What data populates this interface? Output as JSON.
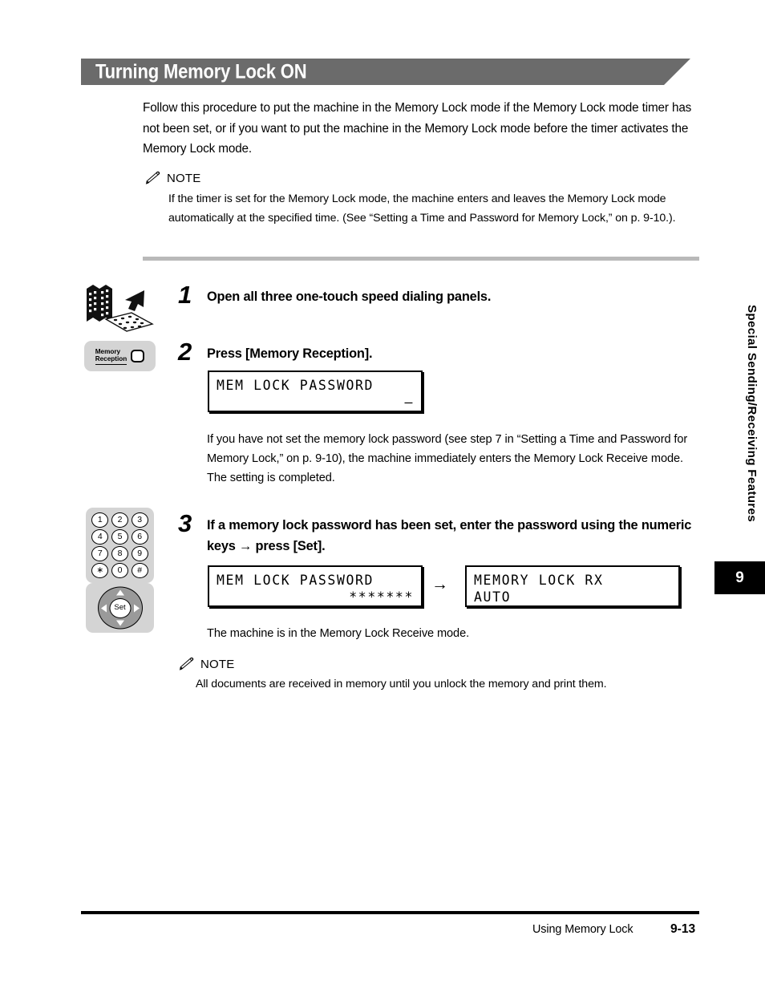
{
  "header": {
    "title": "Turning Memory Lock ON"
  },
  "intro": {
    "text": "Follow this procedure to put the machine in the Memory Lock mode if the Memory Lock mode timer has not been set, or if you want to put the machine in the Memory Lock mode before the timer activates the Memory Lock mode."
  },
  "notes": [
    {
      "label": "NOTE",
      "body": "If the timer is set for the Memory Lock mode, the machine enters and leaves the Memory Lock mode automatically at the specified time. (See “Setting a Time and Password for Memory Lock,” on p. 9-10.)."
    },
    {
      "label": "NOTE",
      "body": "All documents are received in memory until you unlock the memory and print them."
    }
  ],
  "steps": [
    {
      "number": "1",
      "heading": "Open all three one-touch speed dialing panels."
    },
    {
      "number": "2",
      "heading": "Press [Memory Reception].",
      "body": "If you have not set the memory lock password (see step 7 in “Setting a Time and Password for Memory Lock,” on p. 9-10), the machine immediately enters the Memory Lock Receive mode. The setting is completed."
    },
    {
      "number": "3",
      "heading": "If a memory lock password has been set, enter the password using the numeric keys → press [Set].",
      "body": "The machine is in the Memory Lock Receive mode."
    }
  ],
  "lcd": {
    "step2": {
      "line1": "MEM LOCK PASSWORD",
      "line2": "–"
    },
    "step3_before": {
      "line1": "MEM LOCK PASSWORD",
      "line2": "*******"
    },
    "arrow": "→",
    "step3_after": {
      "line1": "MEMORY LOCK RX",
      "line2": "AUTO"
    }
  },
  "keys": {
    "memory_reception": {
      "line1": "Memory",
      "line2": "Reception"
    },
    "numeric_keypad": [
      "1",
      "2",
      "3",
      "4",
      "5",
      "6",
      "7",
      "8",
      "9",
      "∗",
      "0",
      "#"
    ],
    "set_button": "Set"
  },
  "sidebar": {
    "chapter_title": "Special Sending/Receiving Features",
    "chapter_number": "9"
  },
  "footer": {
    "section": "Using Memory Lock",
    "page": "9-13"
  },
  "colors": {
    "banner": "#6b6b6b",
    "divider": "#b9b9b9",
    "key_panel": "#d4d4d4",
    "tab": "#000000"
  }
}
